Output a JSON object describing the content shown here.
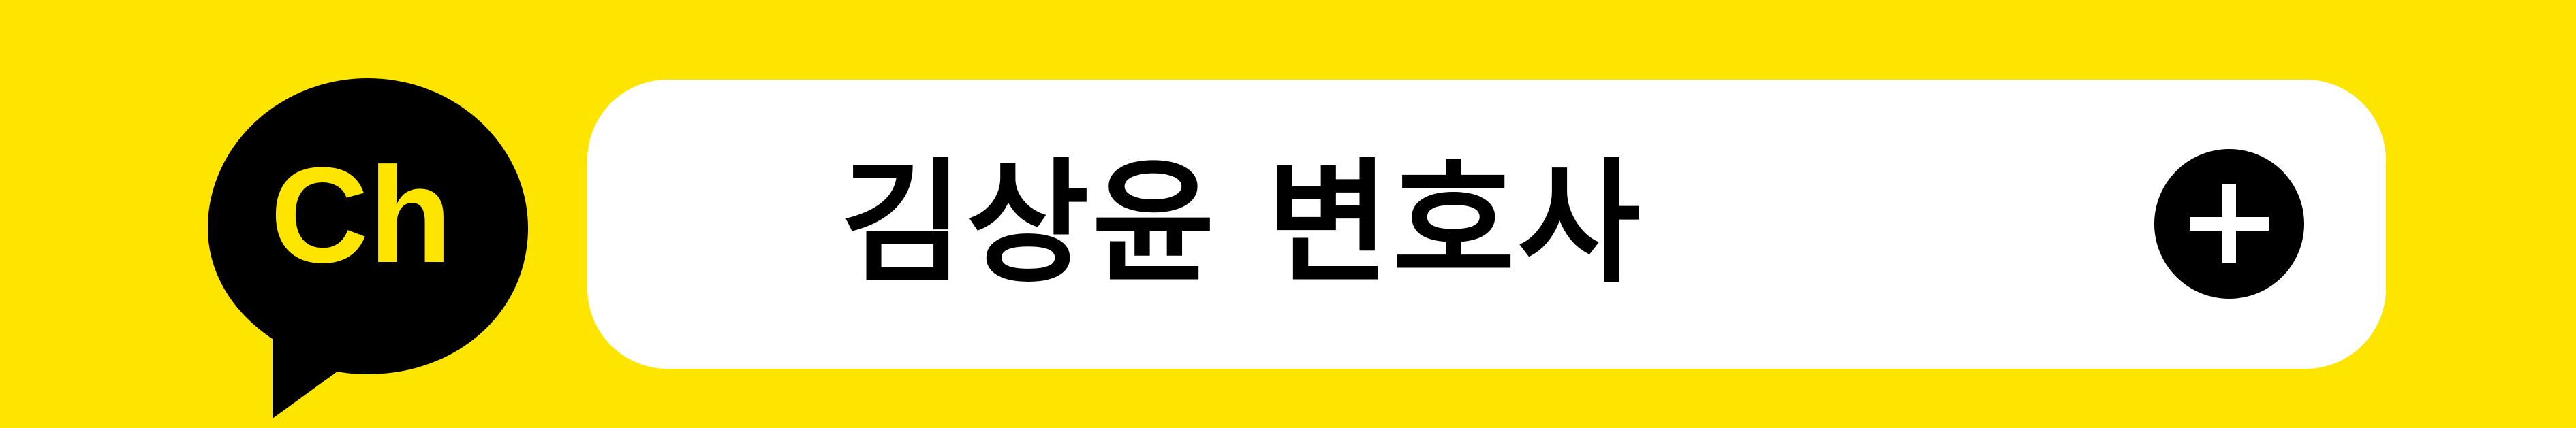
{
  "logo": {
    "text": "Ch",
    "icon": "kakao-channel-speech-bubble-icon"
  },
  "channel": {
    "name": "김상윤 변호사"
  },
  "add_button": {
    "icon": "plus-icon"
  },
  "colors": {
    "background": "#FEE500",
    "bubble": "#000000",
    "logo_text": "#FEE500",
    "pill": "#FFFFFF",
    "name_text": "#000000",
    "button_bg": "#000000",
    "button_icon": "#FFFFFF"
  }
}
